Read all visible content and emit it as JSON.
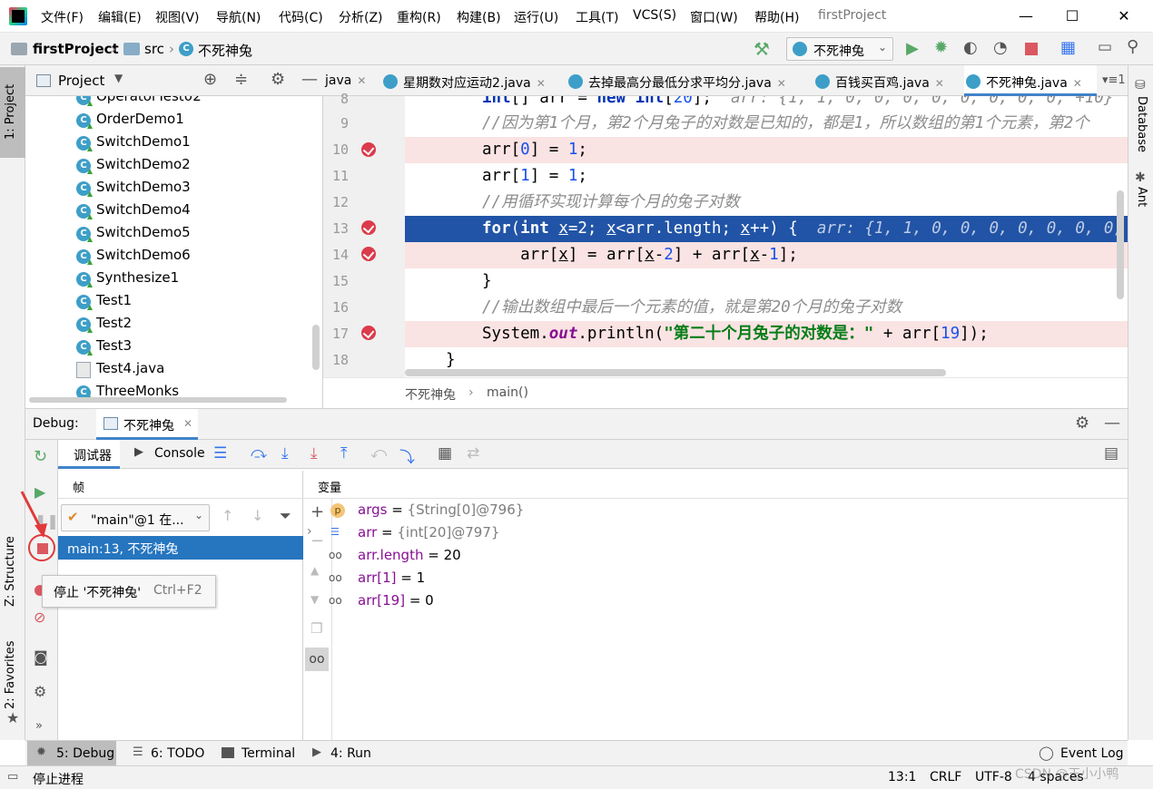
{
  "menu": {
    "items": [
      "文件(F)",
      "编辑(E)",
      "视图(V)",
      "导航(N)",
      "代码(C)",
      "分析(Z)",
      "重构(R)",
      "构建(B)",
      "运行(U)",
      "工具(T)",
      "VCS(S)",
      "窗口(W)",
      "帮助(H)"
    ],
    "window_title": "firstProject"
  },
  "nav": {
    "project": "firstProject",
    "folder": "src",
    "file": "不死神兔",
    "run_config": "不死神兔"
  },
  "project_panel": {
    "title": "Project",
    "items": [
      "OperatorTest02",
      "OrderDemo1",
      "SwitchDemo1",
      "SwitchDemo2",
      "SwitchDemo3",
      "SwitchDemo4",
      "SwitchDemo5",
      "SwitchDemo6",
      "Synthesize1",
      "Test1",
      "Test2",
      "Test3",
      "Test4.java",
      "ThreeMonks"
    ]
  },
  "left_stripe": {
    "project": "1: Project",
    "structure": "Z: Structure",
    "favorites": "2: Favorites"
  },
  "right_stripe": {
    "database": "Database",
    "ant": "Ant"
  },
  "editor": {
    "tabs": [
      "java",
      "星期数对应运动2.java",
      "去掉最高分最低分求平均分.java",
      "百钱买百鸡.java",
      "不死神兔.java"
    ],
    "tab_count": "1",
    "line_numbers": [
      "8",
      "9",
      "10",
      "11",
      "12",
      "13",
      "14",
      "15",
      "16",
      "17",
      "18"
    ],
    "breadcrumb": [
      "不死神兔",
      "main()"
    ]
  },
  "debug": {
    "label": "Debug:",
    "session": "不死神兔",
    "debugger_tab": "调试器",
    "console_tab": "Console",
    "frames_title": "帧",
    "vars_title": "变量",
    "thread": "\"main\"@1 在...",
    "frame": "main:13, 不死神兔",
    "tooltip_text": "停止 '不死神兔'",
    "tooltip_shortcut": "Ctrl+F2",
    "variables": [
      {
        "name": "args",
        "value": "{String[0]@796}"
      },
      {
        "name": "arr",
        "value": "{int[20]@797}"
      },
      {
        "name": "arr.length",
        "value": "= 20"
      },
      {
        "name": "arr[1]",
        "value": "= 1"
      },
      {
        "name": "arr[19]",
        "value": "= 0"
      }
    ]
  },
  "bottom_tabs": [
    "5: Debug",
    "6: TODO",
    "Terminal",
    "4: Run"
  ],
  "event_log": "Event Log",
  "status": {
    "message": "停止进程",
    "position": "13:1",
    "line_ending": "CRLF",
    "encoding": "UTF-8",
    "indent": "4 spaces",
    "watermark": "CSDN @王小小鸭"
  }
}
